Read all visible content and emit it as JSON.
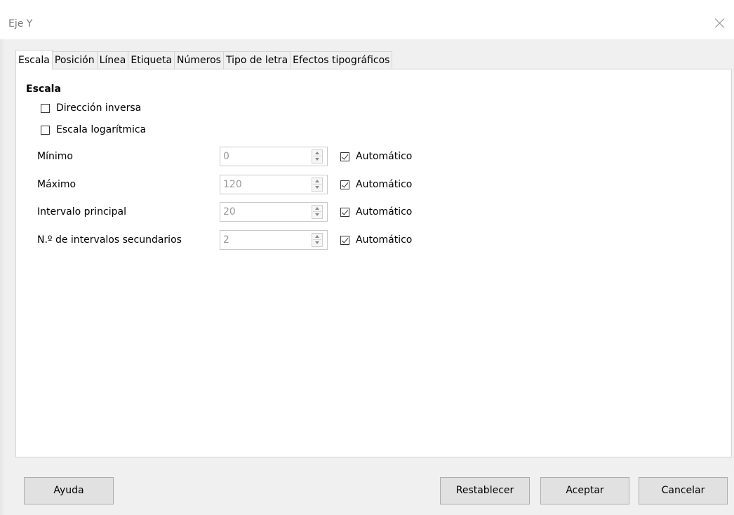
{
  "window": {
    "title": "Eje Y"
  },
  "tabs": [
    {
      "label": "Escala",
      "active": true
    },
    {
      "label": "Posición"
    },
    {
      "label": "Línea"
    },
    {
      "label": "Etiqueta"
    },
    {
      "label": "Números"
    },
    {
      "label": "Tipo de letra"
    },
    {
      "label": "Efectos tipográficos"
    }
  ],
  "scale": {
    "section_title": "Escala",
    "reverse_direction": {
      "label": "Dirección inversa",
      "checked": false
    },
    "log_scale": {
      "label": "Escala logarítmica",
      "checked": false
    },
    "fields": [
      {
        "label": "Mínimo",
        "value": "0",
        "auto_label": "Automático",
        "auto_checked": true
      },
      {
        "label": "Máximo",
        "value": "120",
        "auto_label": "Automático",
        "auto_checked": true
      },
      {
        "label": "Intervalo principal",
        "value": "20",
        "auto_label": "Automático",
        "auto_checked": true
      },
      {
        "label": "N.º de intervalos secundarios",
        "value": "2",
        "auto_label": "Automático",
        "auto_checked": true
      }
    ]
  },
  "buttons": {
    "help": "Ayuda",
    "reset": "Restablecer",
    "ok": "Aceptar",
    "cancel": "Cancelar"
  }
}
